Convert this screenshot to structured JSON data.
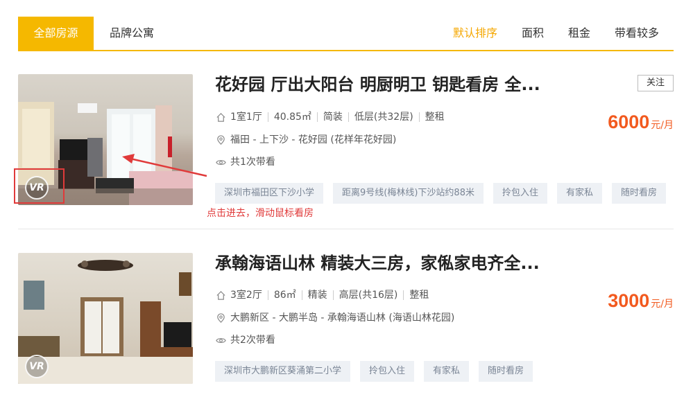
{
  "tabs": {
    "all": "全部房源",
    "brand": "品牌公寓"
  },
  "sort": {
    "default": "默认排序",
    "area": "面积",
    "rent": "租金",
    "views": "带看较多"
  },
  "colors": {
    "accent": "#f5b800",
    "price": "#f25a1f",
    "annotation": "#e03a3a",
    "tag_bg": "#eef1f5"
  },
  "listings": [
    {
      "title": "花好园 厅出大阳台 明厨明卫 钥匙看房 全...",
      "follow": "关注",
      "badge": "VR",
      "rooms": "1室1厅",
      "area": "40.85㎡",
      "decoration": "简装",
      "floor": "低层(共32层)",
      "rent_type": "整租",
      "location": "福田 - 上下沙 - 花好园 (花样年花好园)",
      "viewings": "共1次带看",
      "price": "6000",
      "price_unit": "元/月",
      "tags": [
        "深圳市福田区下沙小学",
        "距离9号线(梅林线)下沙站约88米",
        "拎包入住",
        "有家私",
        "随时看房"
      ]
    },
    {
      "title": "承翰海语山林 精装大三房，家俬家电齐全...",
      "badge": "VR",
      "rooms": "3室2厅",
      "area": "86㎡",
      "decoration": "精装",
      "floor": "高层(共16层)",
      "rent_type": "整租",
      "location": "大鹏新区 - 大鹏半岛 - 承翰海语山林 (海语山林花园)",
      "viewings": "共2次带看",
      "price": "3000",
      "price_unit": "元/月",
      "tags": [
        "深圳市大鹏新区葵涌第二小学",
        "拎包入住",
        "有家私",
        "随时看房"
      ]
    }
  ],
  "annotation": {
    "text": "点击进去，滑动鼠标看房"
  }
}
